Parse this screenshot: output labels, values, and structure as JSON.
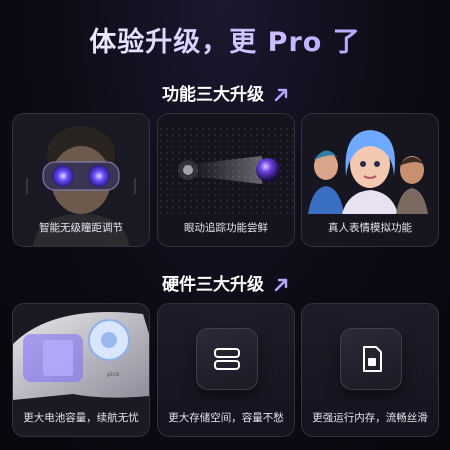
{
  "headline": "体验升级，更 Pro 了",
  "sections": [
    {
      "title": "功能三大升级",
      "cards": [
        {
          "label": "智能无级瞳距调节",
          "image": "vr-headset-wearer"
        },
        {
          "label": "眼动追踪功能尝鲜",
          "image": "eye-tracking-sphere"
        },
        {
          "label": "真人表情模拟功能",
          "image": "avatar-faces"
        }
      ]
    },
    {
      "title": "硬件三大升级",
      "cards": [
        {
          "label": "更大电池容量，续航无忧",
          "image": "headset-battery-closeup"
        },
        {
          "label": "更大存储空间，容量不愁",
          "image": "storage-icon"
        },
        {
          "label": "更强运行内存，流畅丝滑",
          "image": "memory-card-icon"
        }
      ]
    }
  ],
  "colors": {
    "accent": "#a791ff",
    "background": "#0c0b14"
  }
}
